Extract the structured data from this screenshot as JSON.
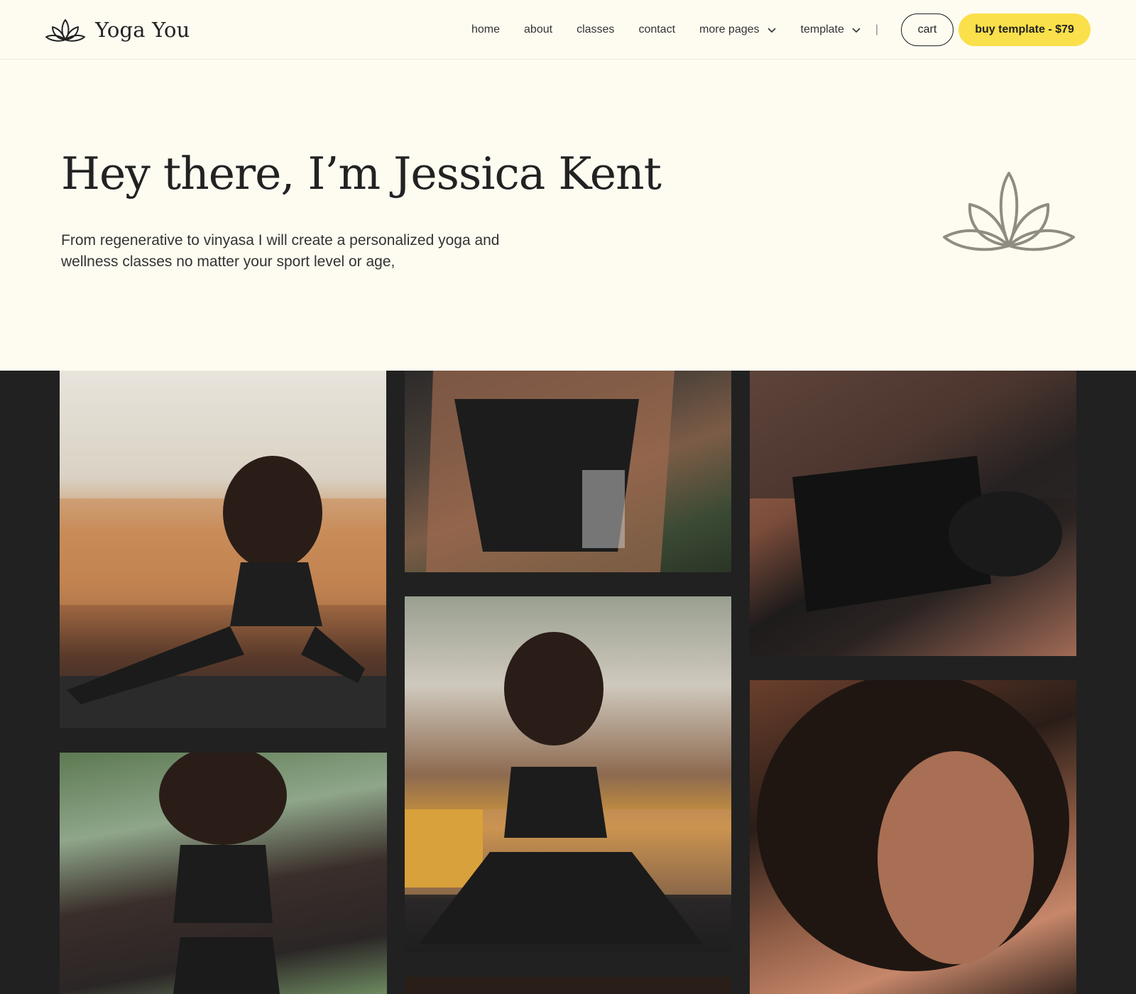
{
  "brand": {
    "name": "Yoga You",
    "icon": "lotus-icon"
  },
  "nav": {
    "home": "home",
    "about": "about",
    "classes": "classes",
    "contact": "contact",
    "more_pages": "more pages",
    "template": "template",
    "separator": "|"
  },
  "actions": {
    "cart": "cart",
    "buy": "buy template - $79"
  },
  "hero": {
    "title": "Hey there, I’m Jessica Kent",
    "subtitle": "From regenerative to vinyasa I will create a personalized yoga and wellness classes no matter your sport level or age,",
    "icon": "lotus-icon"
  },
  "colors": {
    "background": "#fefcf1",
    "accent": "#fae04a",
    "gallery_bg": "#212121",
    "lotus_stroke": "#8f8c82"
  }
}
